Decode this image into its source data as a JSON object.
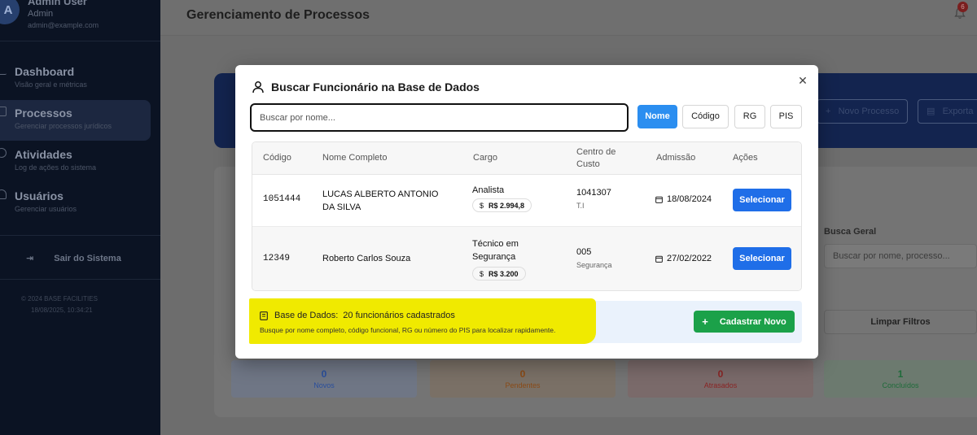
{
  "sidebar": {
    "avatar_letter": "A",
    "user_name": "Admin User",
    "user_role": "Admin",
    "user_email": "admin@example.com",
    "items": [
      {
        "label": "Dashboard",
        "sub": "Visão geral e métricas",
        "icon": "chart-icon"
      },
      {
        "label": "Processos",
        "sub": "Gerenciar processos jurídicos",
        "icon": "document-icon"
      },
      {
        "label": "Atividades",
        "sub": "Log de ações do sistema",
        "icon": "clock-icon"
      },
      {
        "label": "Usuários",
        "sub": "Gerenciar usuários",
        "icon": "users-icon"
      }
    ],
    "logout_label": "Sair do Sistema",
    "footer_copyright": "© 2024 BASE FACILITIES",
    "footer_timestamp": "18/08/2025, 10:34:21"
  },
  "header": {
    "page_title": "Gerenciamento de Processos",
    "notification_count": "6"
  },
  "hero": {
    "new_process_label": "Novo Processo",
    "export_label": "Exporta"
  },
  "filters": {
    "general_search_label": "Busca Geral",
    "general_search_placeholder": "Buscar por nome, processo...",
    "clear_filters_label": "Limpar Filtros"
  },
  "stats": [
    {
      "value": "0",
      "label": "Novos",
      "color": "#2a4f9c"
    },
    {
      "value": "0",
      "label": "Pendentes",
      "color": "#8a4a16"
    },
    {
      "value": "0",
      "label": "Atrasados",
      "color": "#8a2424"
    },
    {
      "value": "1",
      "label": "Concluídos",
      "color": "#1f6b3a"
    }
  ],
  "modal": {
    "title": "Buscar Funcionário na Base de Dados",
    "search_placeholder": "Buscar por nome...",
    "search_value": "",
    "filter_buttons": [
      {
        "label": "Nome",
        "active": true
      },
      {
        "label": "Código",
        "active": false
      },
      {
        "label": "RG",
        "active": false
      },
      {
        "label": "PIS",
        "active": false
      }
    ],
    "columns": [
      "Código",
      "Nome Completo",
      "Cargo",
      "Centro de Custo",
      "Admissão",
      "Ações"
    ],
    "rows": [
      {
        "code": "1051444",
        "name": "LUCAS ALBERTO ANTONIO DA SILVA",
        "role": "Analista",
        "salary": "R$ 2.994,8",
        "cost_center": "1041307",
        "cost_center_sub": "T.I",
        "admission": "18/08/2024",
        "action": "Selecionar"
      },
      {
        "code": "12349",
        "name": "Roberto Carlos Souza",
        "role": "Técnico em Segurança",
        "salary": "R$ 3.200",
        "cost_center": "005",
        "cost_center_sub": "Segurança",
        "admission": "27/02/2022",
        "action": "Selecionar"
      }
    ],
    "info": {
      "db_label": "Base de Dados:",
      "db_count": "20 funcionários cadastrados",
      "hint": "Busque por nome completo, código funcional, RG ou número do PIS para localizar rapidamente."
    },
    "register_button": "Cadastrar Novo",
    "colors": {
      "primary_blue": "#1f6ee8",
      "active_filter": "#2b8ef0",
      "success_green": "#1ba149",
      "highlight_yellow": "#f0ea00"
    }
  }
}
